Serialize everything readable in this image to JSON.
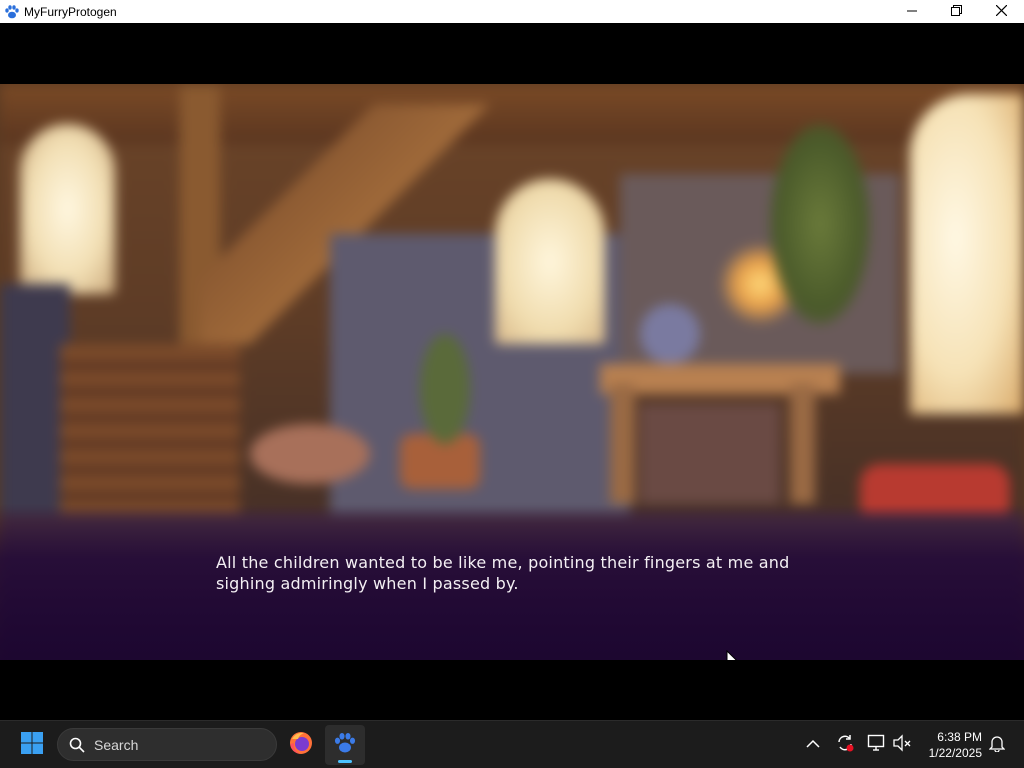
{
  "window": {
    "title": "MyFurryProtogen",
    "icon": "paw-icon",
    "controls": [
      "minimize-icon",
      "restore-icon",
      "close-icon"
    ]
  },
  "game": {
    "dialogue": "All the children wanted to be like me, pointing their fingers at me and sighing admiringly when I passed by."
  },
  "taskbar": {
    "search_label": "Search",
    "apps": [
      "firefox-icon",
      "paw-icon"
    ],
    "tray_icons": [
      "chevron-up-icon",
      "sync-icon",
      "display-icon",
      "speaker-muted-icon",
      "bell-icon"
    ],
    "time": "6:38 PM",
    "date": "1/22/2025"
  },
  "colors": {
    "accent": "#4cc2ff",
    "dialog_bg": "#1e0830",
    "taskbar_bg": "#1c1c1c"
  }
}
